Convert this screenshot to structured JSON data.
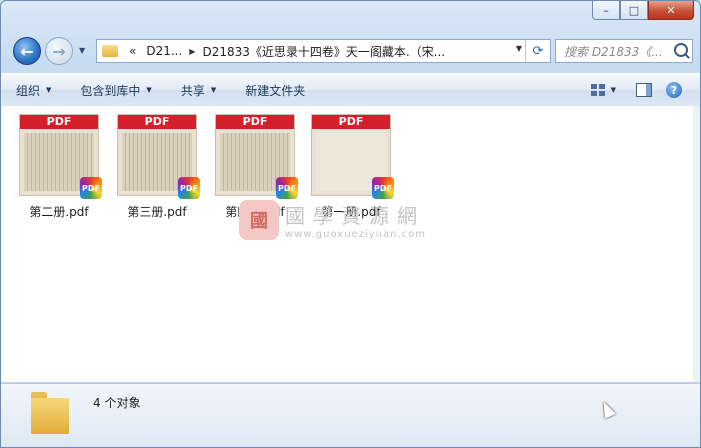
{
  "window": {
    "minimize_glyph": "–",
    "maximize_glyph": "□",
    "close_glyph": "✕"
  },
  "nav": {
    "back_glyph": "←",
    "forward_glyph": "→"
  },
  "address": {
    "prefix": "«",
    "segment_1": "D21...",
    "segment_2": "D21833《近思录十四卷》天一阁藏本.（宋...",
    "sep": "▶"
  },
  "search": {
    "placeholder": "搜索 D21833《..."
  },
  "toolbar": {
    "organize": "组织",
    "include_in_library": "包含到库中",
    "share": "共享",
    "new_folder": "新建文件夹"
  },
  "files": [
    {
      "name": "第二册.pdf",
      "band": "PDF",
      "badge": "PDF"
    },
    {
      "name": "第三册.pdf",
      "band": "PDF",
      "badge": "PDF"
    },
    {
      "name": "第四册.pdf",
      "band": "PDF",
      "badge": "PDF"
    },
    {
      "name": "第一册.pdf",
      "band": "PDF",
      "badge": "PDF"
    }
  ],
  "watermark": {
    "seal": "國",
    "chinese": "國學資源網",
    "url": "www.guoxueziyuan.com"
  },
  "details": {
    "count_text": "4 个对象"
  }
}
